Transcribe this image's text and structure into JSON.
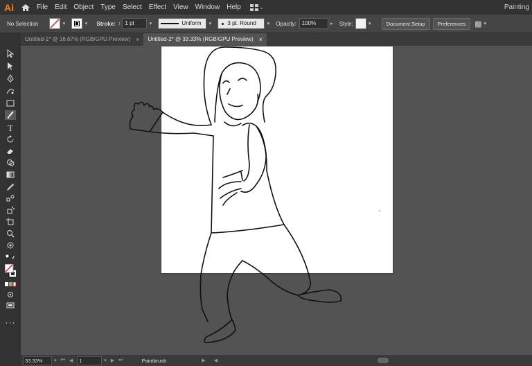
{
  "app": {
    "logo": "Ai",
    "workspace": "Painting"
  },
  "menu": [
    "File",
    "Edit",
    "Object",
    "Type",
    "Select",
    "Effect",
    "View",
    "Window",
    "Help"
  ],
  "control": {
    "selection": "No Selection",
    "stroke_label": "Stroke:",
    "stroke_weight": "1 pt",
    "profile": "Uniform",
    "brush": "3 pt. Round",
    "opacity_label": "Opacity:",
    "opacity_value": "100%",
    "style_label": "Style:",
    "document_setup": "Document Setup",
    "preferences": "Preferences"
  },
  "tabs": [
    {
      "label": "Untitled-1* @ 16.67% (RGB/GPU Preview)",
      "active": false
    },
    {
      "label": "Untitled-2* @ 33.33% (RGB/GPU Preview)",
      "active": true
    }
  ],
  "status": {
    "zoom": "33.33%",
    "page": "1",
    "tool": "Paintbrush"
  },
  "tools": [
    "selection-tool-icon",
    "direct-selection-tool-icon",
    "pen-tool-icon",
    "curvature-tool-icon",
    "rectangle-tool-icon",
    "paintbrush-tool-icon",
    "type-tool-icon",
    "rotate-tool-icon",
    "eraser-tool-icon",
    "shape-builder-tool-icon",
    "gradient-tool-icon",
    "eyedropper-tool-icon",
    "blend-tool-icon",
    "symbol-sprayer-tool-icon",
    "artboard-tool-icon",
    "zoom-tool-icon",
    "hand-tool-icon"
  ],
  "colors": {
    "accent": "#ff7c00",
    "ui_dark": "#323232",
    "canvas": "#535353",
    "artboard": "#ffffff"
  }
}
